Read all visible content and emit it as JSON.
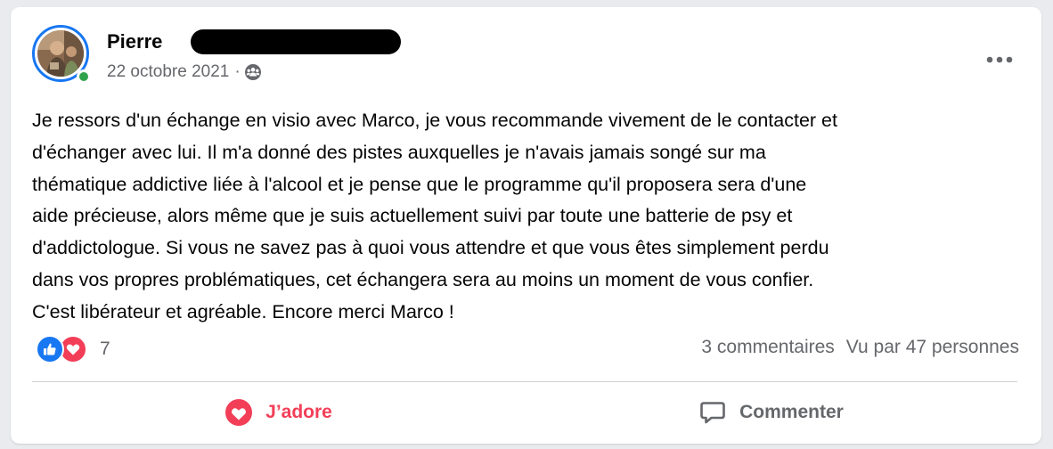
{
  "post": {
    "author": {
      "name": "Pierre",
      "online": true
    },
    "date": "22 octobre 2021",
    "separator": "·",
    "audience_icon": "group-icon",
    "text": "Je ressors d'un échange en visio avec Marco, je vous recommande vivement de le contacter et\nd'échanger avec lui. Il m'a donné des pistes auxquelles je n'avais jamais songé sur ma\nthématique addictive liée à l'alcool et je pense que le programme qu'il proposera sera d'une\naide précieuse, alors même que je suis actuellement suivi par toute une batterie de psy et\nd'addictologue. Si vous ne savez pas à quoi vous attendre et que vous êtes simplement perdu\ndans vos propres problématiques, cet échangera sera au moins un moment de vous confier.\nC'est libérateur et agréable. Encore merci Marco !",
    "reactions": {
      "types": [
        "like",
        "love"
      ],
      "count": "7"
    },
    "comments_label": "3 commentaires",
    "views_label": "Vu par 47 personnes"
  },
  "actions": {
    "love_label": "J’adore",
    "comment_label": "Commenter"
  },
  "colors": {
    "accent_blue": "#1877f2",
    "love_red": "#f33e58",
    "online_green": "#31a24c",
    "secondary_text": "#65676b"
  },
  "icons": {
    "more": "more-horizontal-icon",
    "like": "thumbs-up-icon",
    "love": "heart-icon",
    "comment": "comment-bubble-icon"
  }
}
